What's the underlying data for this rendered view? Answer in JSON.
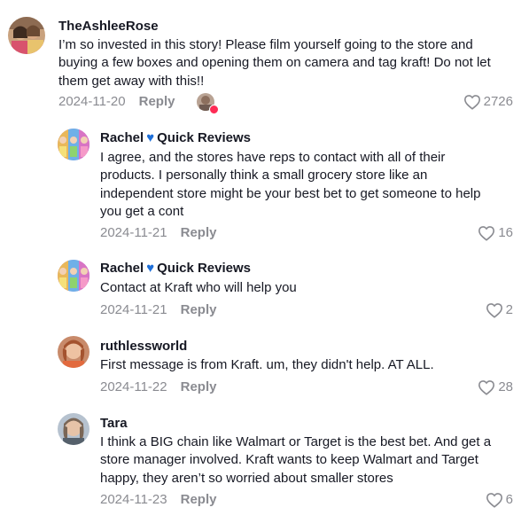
{
  "comments": [
    {
      "username": "TheAshleeRose",
      "text": "I’m so invested in this story! Please film yourself going to the store and buying a few boxes and opening them on camera and tag kraft! Do not let them get away with this!!",
      "date": "2024-11-20",
      "reply_label": "Reply",
      "likes": "2726"
    },
    {
      "username": "Rachel",
      "username_suffix": "Quick Reviews",
      "text": "I agree, and the stores have reps to contact with all of their products. I personally think a small grocery store like an independent store might be your best bet to get someone to help you get a cont",
      "date": "2024-11-21",
      "reply_label": "Reply",
      "likes": "16"
    },
    {
      "username": "Rachel",
      "username_suffix": "Quick Reviews",
      "text": "Contact at Kraft who will help you",
      "date": "2024-11-21",
      "reply_label": "Reply",
      "likes": "2"
    },
    {
      "username": "ruthlessworld",
      "text": "First message is from Kraft. um, they didn't help. AT ALL.",
      "date": "2024-11-22",
      "reply_label": "Reply",
      "likes": "28"
    },
    {
      "username": "Tara",
      "text": "I think a BIG chain like Walmart or Target is the best bet. And get a store manager involved. Kraft wants to keep Walmart and Target happy, they aren’t so worried about smaller stores",
      "date": "2024-11-23",
      "reply_label": "Reply",
      "likes": "6"
    }
  ],
  "colors": {
    "text": "#161823",
    "muted": "#8a8b91",
    "heart_emoji": "#1e6fd9",
    "badge": "#fe2c55"
  }
}
